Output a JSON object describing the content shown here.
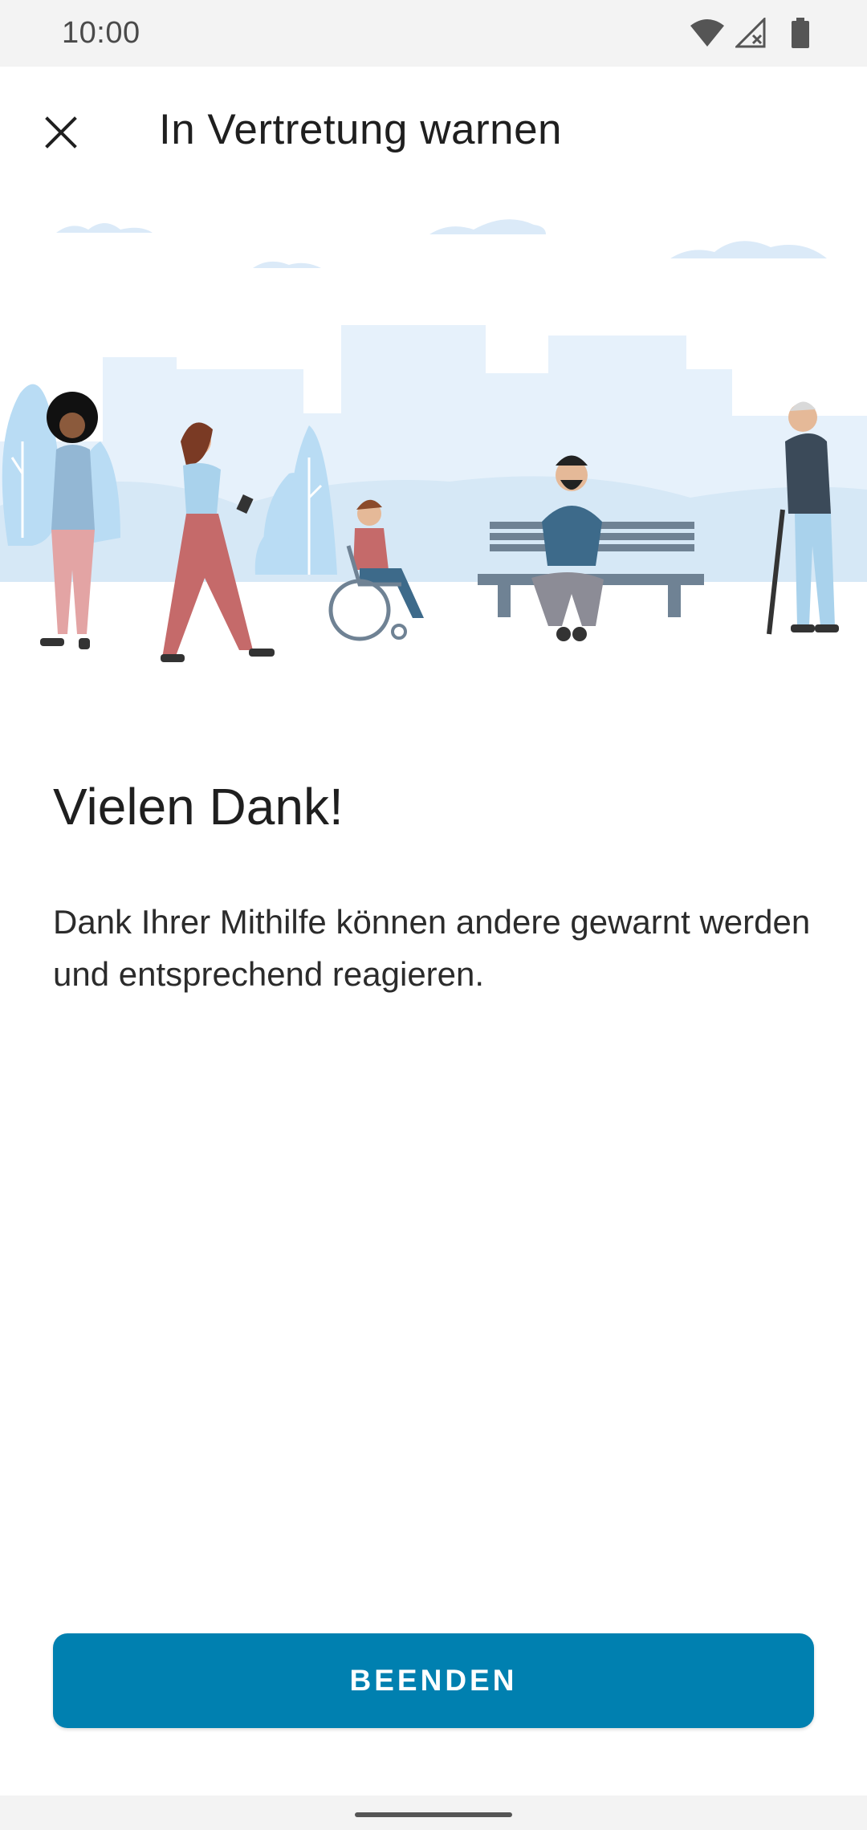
{
  "status_bar": {
    "time": "10:00",
    "icons": [
      "wifi-icon",
      "signal-icon",
      "battery-icon"
    ]
  },
  "app_bar": {
    "title": "In Vertretung warnen",
    "close_icon": "close-icon"
  },
  "content": {
    "headline": "Vielen Dank!",
    "body": "Dank Ihrer Mithilfe können andere gewarnt werden und entsprechend reagieren."
  },
  "actions": {
    "finish_label": "BEENDEN"
  },
  "colors": {
    "primary": "#0080b0",
    "illustration_light": "#e6f1fb",
    "illustration_mid": "#b9dcf4"
  }
}
